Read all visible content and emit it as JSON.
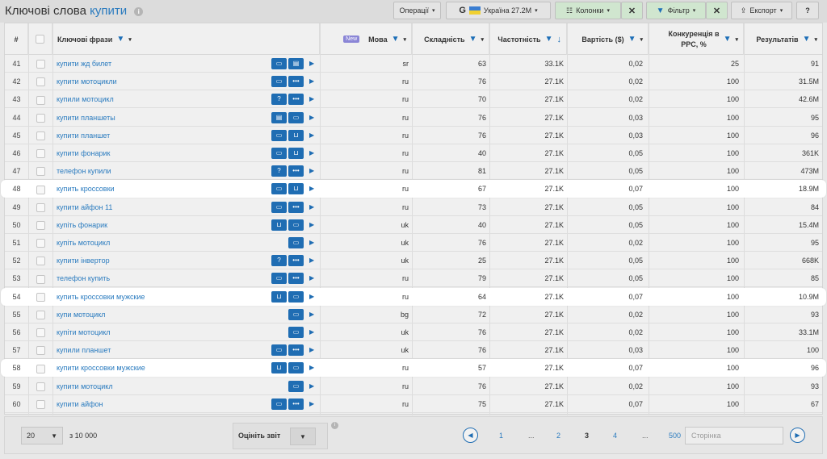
{
  "header": {
    "title_prefix": "Ключові слова",
    "title_keyword": "купити",
    "info": "i",
    "operations_label": "Операції",
    "google_label": "G",
    "country_label": "Україна 27.2M",
    "columns_label": "Колонки",
    "filter_label": "Фільтр",
    "export_label": "Експорт",
    "help_label": "?",
    "close_glyph": "✕",
    "caret": "▾"
  },
  "table": {
    "headers": {
      "num": "#",
      "keyword": "Ключові фрази",
      "new_badge": "New",
      "lang": "Мова",
      "difficulty": "Складність",
      "frequency": "Частотність",
      "cost": "Вартість ($)",
      "competition_1": "Конкуренція в",
      "competition_2": "PPC, %",
      "results": "Результатів"
    },
    "rows": [
      {
        "n": "41",
        "kw": "купити жд билет",
        "lang": "sr",
        "diff": "63",
        "freq": "33.1K",
        "cost": "0,02",
        "comp": "25",
        "res": "91",
        "icons": [
          "chat",
          "cal"
        ],
        "hl": false
      },
      {
        "n": "42",
        "kw": "купити мотоцикли",
        "lang": "ru",
        "diff": "76",
        "freq": "27.1K",
        "cost": "0,02",
        "comp": "100",
        "res": "31.5M",
        "icons": [
          "chat",
          "dots"
        ],
        "hl": false
      },
      {
        "n": "43",
        "kw": "купили мотоцикл",
        "lang": "ru",
        "diff": "70",
        "freq": "27.1K",
        "cost": "0,02",
        "comp": "100",
        "res": "42.6M",
        "icons": [
          "q",
          "dots"
        ],
        "hl": false
      },
      {
        "n": "44",
        "kw": "купити планшеты",
        "lang": "ru",
        "diff": "76",
        "freq": "27.1K",
        "cost": "0,03",
        "comp": "100",
        "res": "95",
        "icons": [
          "cal",
          "chat"
        ],
        "hl": false
      },
      {
        "n": "45",
        "kw": "купити планшет",
        "lang": "ru",
        "diff": "76",
        "freq": "27.1K",
        "cost": "0,03",
        "comp": "100",
        "res": "96",
        "icons": [
          "chat",
          "cart"
        ],
        "hl": false
      },
      {
        "n": "46",
        "kw": "купити фонарик",
        "lang": "ru",
        "diff": "40",
        "freq": "27.1K",
        "cost": "0,05",
        "comp": "100",
        "res": "361K",
        "icons": [
          "chat",
          "cart"
        ],
        "hl": false
      },
      {
        "n": "47",
        "kw": "телефон купили",
        "lang": "ru",
        "diff": "81",
        "freq": "27.1K",
        "cost": "0,05",
        "comp": "100",
        "res": "473M",
        "icons": [
          "q",
          "dots"
        ],
        "hl": false
      },
      {
        "n": "48",
        "kw": "купить кроссовки",
        "lang": "ru",
        "diff": "67",
        "freq": "27.1K",
        "cost": "0,07",
        "comp": "100",
        "res": "18.9M",
        "icons": [
          "chat",
          "cart"
        ],
        "hl": true
      },
      {
        "n": "49",
        "kw": "купити айфон 11",
        "lang": "ru",
        "diff": "73",
        "freq": "27.1K",
        "cost": "0,05",
        "comp": "100",
        "res": "84",
        "icons": [
          "chat",
          "dots"
        ],
        "hl": false
      },
      {
        "n": "50",
        "kw": "купіть фонарик",
        "lang": "uk",
        "diff": "40",
        "freq": "27.1K",
        "cost": "0,05",
        "comp": "100",
        "res": "15.4M",
        "icons": [
          "cart",
          "chat"
        ],
        "hl": false
      },
      {
        "n": "51",
        "kw": "купіть мотоцикл",
        "lang": "uk",
        "diff": "76",
        "freq": "27.1K",
        "cost": "0,02",
        "comp": "100",
        "res": "95",
        "icons": [
          "chat"
        ],
        "hl": false
      },
      {
        "n": "52",
        "kw": "купити інвертор",
        "lang": "uk",
        "diff": "25",
        "freq": "27.1K",
        "cost": "0,05",
        "comp": "100",
        "res": "668K",
        "icons": [
          "q",
          "dots"
        ],
        "hl": false
      },
      {
        "n": "53",
        "kw": "телефон купить",
        "lang": "ru",
        "diff": "79",
        "freq": "27.1K",
        "cost": "0,05",
        "comp": "100",
        "res": "85",
        "icons": [
          "chat",
          "dots"
        ],
        "hl": false
      },
      {
        "n": "54",
        "kw": "купить кроссовки мужские",
        "lang": "ru",
        "diff": "64",
        "freq": "27.1K",
        "cost": "0,07",
        "comp": "100",
        "res": "10.9M",
        "icons": [
          "cart",
          "chat"
        ],
        "hl": true
      },
      {
        "n": "55",
        "kw": "купи мотоцикл",
        "lang": "bg",
        "diff": "72",
        "freq": "27.1K",
        "cost": "0,02",
        "comp": "100",
        "res": "93",
        "icons": [
          "chat"
        ],
        "hl": false
      },
      {
        "n": "56",
        "kw": "купіти мотоцикл",
        "lang": "uk",
        "diff": "76",
        "freq": "27.1K",
        "cost": "0,02",
        "comp": "100",
        "res": "33.1M",
        "icons": [
          "chat"
        ],
        "hl": false
      },
      {
        "n": "57",
        "kw": "купили планшет",
        "lang": "uk",
        "diff": "76",
        "freq": "27.1K",
        "cost": "0,03",
        "comp": "100",
        "res": "100",
        "icons": [
          "chat",
          "dots"
        ],
        "hl": false
      },
      {
        "n": "58",
        "kw": "купити кроссовки мужские",
        "lang": "ru",
        "diff": "57",
        "freq": "27.1K",
        "cost": "0,07",
        "comp": "100",
        "res": "96",
        "icons": [
          "cart",
          "chat"
        ],
        "hl": true
      },
      {
        "n": "59",
        "kw": "купити мотоцикл",
        "lang": "ru",
        "diff": "76",
        "freq": "27.1K",
        "cost": "0,02",
        "comp": "100",
        "res": "93",
        "icons": [
          "chat"
        ],
        "hl": false
      },
      {
        "n": "60",
        "kw": "купити айфон",
        "lang": "ru",
        "diff": "75",
        "freq": "27.1K",
        "cost": "0,07",
        "comp": "100",
        "res": "67",
        "icons": [
          "chat",
          "dots"
        ],
        "hl": false
      }
    ]
  },
  "footer": {
    "per_page": "20",
    "of_total": "з 10 000",
    "rate_label": "Оцініть звіт",
    "pages": [
      "1",
      "...",
      "2",
      "3",
      "4",
      "...",
      "500"
    ],
    "current_page": "3",
    "page_placeholder": "Сторінка"
  },
  "colors": {
    "accent": "#1f6db3",
    "link": "#2a7bbf",
    "green": "#d0e6cf"
  }
}
